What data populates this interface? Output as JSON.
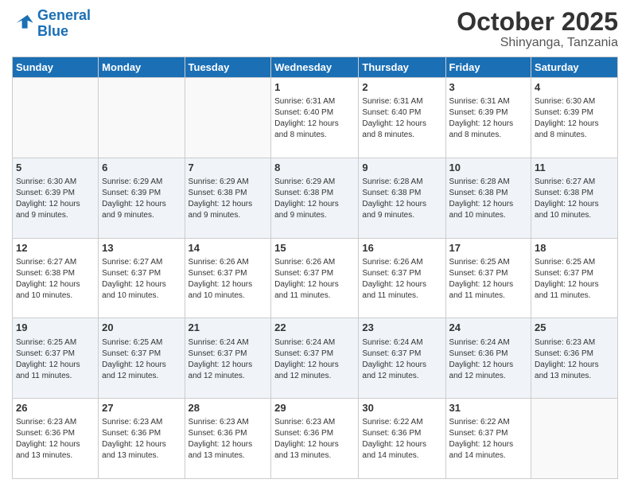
{
  "header": {
    "logo_line1": "General",
    "logo_line2": "Blue",
    "month": "October 2025",
    "location": "Shinyanga, Tanzania"
  },
  "weekdays": [
    "Sunday",
    "Monday",
    "Tuesday",
    "Wednesday",
    "Thursday",
    "Friday",
    "Saturday"
  ],
  "weeks": [
    [
      {
        "day": "",
        "info": ""
      },
      {
        "day": "",
        "info": ""
      },
      {
        "day": "",
        "info": ""
      },
      {
        "day": "1",
        "info": "Sunrise: 6:31 AM\nSunset: 6:40 PM\nDaylight: 12 hours\nand 8 minutes."
      },
      {
        "day": "2",
        "info": "Sunrise: 6:31 AM\nSunset: 6:40 PM\nDaylight: 12 hours\nand 8 minutes."
      },
      {
        "day": "3",
        "info": "Sunrise: 6:31 AM\nSunset: 6:39 PM\nDaylight: 12 hours\nand 8 minutes."
      },
      {
        "day": "4",
        "info": "Sunrise: 6:30 AM\nSunset: 6:39 PM\nDaylight: 12 hours\nand 8 minutes."
      }
    ],
    [
      {
        "day": "5",
        "info": "Sunrise: 6:30 AM\nSunset: 6:39 PM\nDaylight: 12 hours\nand 9 minutes."
      },
      {
        "day": "6",
        "info": "Sunrise: 6:29 AM\nSunset: 6:39 PM\nDaylight: 12 hours\nand 9 minutes."
      },
      {
        "day": "7",
        "info": "Sunrise: 6:29 AM\nSunset: 6:38 PM\nDaylight: 12 hours\nand 9 minutes."
      },
      {
        "day": "8",
        "info": "Sunrise: 6:29 AM\nSunset: 6:38 PM\nDaylight: 12 hours\nand 9 minutes."
      },
      {
        "day": "9",
        "info": "Sunrise: 6:28 AM\nSunset: 6:38 PM\nDaylight: 12 hours\nand 9 minutes."
      },
      {
        "day": "10",
        "info": "Sunrise: 6:28 AM\nSunset: 6:38 PM\nDaylight: 12 hours\nand 10 minutes."
      },
      {
        "day": "11",
        "info": "Sunrise: 6:27 AM\nSunset: 6:38 PM\nDaylight: 12 hours\nand 10 minutes."
      }
    ],
    [
      {
        "day": "12",
        "info": "Sunrise: 6:27 AM\nSunset: 6:38 PM\nDaylight: 12 hours\nand 10 minutes."
      },
      {
        "day": "13",
        "info": "Sunrise: 6:27 AM\nSunset: 6:37 PM\nDaylight: 12 hours\nand 10 minutes."
      },
      {
        "day": "14",
        "info": "Sunrise: 6:26 AM\nSunset: 6:37 PM\nDaylight: 12 hours\nand 10 minutes."
      },
      {
        "day": "15",
        "info": "Sunrise: 6:26 AM\nSunset: 6:37 PM\nDaylight: 12 hours\nand 11 minutes."
      },
      {
        "day": "16",
        "info": "Sunrise: 6:26 AM\nSunset: 6:37 PM\nDaylight: 12 hours\nand 11 minutes."
      },
      {
        "day": "17",
        "info": "Sunrise: 6:25 AM\nSunset: 6:37 PM\nDaylight: 12 hours\nand 11 minutes."
      },
      {
        "day": "18",
        "info": "Sunrise: 6:25 AM\nSunset: 6:37 PM\nDaylight: 12 hours\nand 11 minutes."
      }
    ],
    [
      {
        "day": "19",
        "info": "Sunrise: 6:25 AM\nSunset: 6:37 PM\nDaylight: 12 hours\nand 11 minutes."
      },
      {
        "day": "20",
        "info": "Sunrise: 6:25 AM\nSunset: 6:37 PM\nDaylight: 12 hours\nand 12 minutes."
      },
      {
        "day": "21",
        "info": "Sunrise: 6:24 AM\nSunset: 6:37 PM\nDaylight: 12 hours\nand 12 minutes."
      },
      {
        "day": "22",
        "info": "Sunrise: 6:24 AM\nSunset: 6:37 PM\nDaylight: 12 hours\nand 12 minutes."
      },
      {
        "day": "23",
        "info": "Sunrise: 6:24 AM\nSunset: 6:37 PM\nDaylight: 12 hours\nand 12 minutes."
      },
      {
        "day": "24",
        "info": "Sunrise: 6:24 AM\nSunset: 6:36 PM\nDaylight: 12 hours\nand 12 minutes."
      },
      {
        "day": "25",
        "info": "Sunrise: 6:23 AM\nSunset: 6:36 PM\nDaylight: 12 hours\nand 13 minutes."
      }
    ],
    [
      {
        "day": "26",
        "info": "Sunrise: 6:23 AM\nSunset: 6:36 PM\nDaylight: 12 hours\nand 13 minutes."
      },
      {
        "day": "27",
        "info": "Sunrise: 6:23 AM\nSunset: 6:36 PM\nDaylight: 12 hours\nand 13 minutes."
      },
      {
        "day": "28",
        "info": "Sunrise: 6:23 AM\nSunset: 6:36 PM\nDaylight: 12 hours\nand 13 minutes."
      },
      {
        "day": "29",
        "info": "Sunrise: 6:23 AM\nSunset: 6:36 PM\nDaylight: 12 hours\nand 13 minutes."
      },
      {
        "day": "30",
        "info": "Sunrise: 6:22 AM\nSunset: 6:36 PM\nDaylight: 12 hours\nand 14 minutes."
      },
      {
        "day": "31",
        "info": "Sunrise: 6:22 AM\nSunset: 6:37 PM\nDaylight: 12 hours\nand 14 minutes."
      },
      {
        "day": "",
        "info": ""
      }
    ]
  ]
}
